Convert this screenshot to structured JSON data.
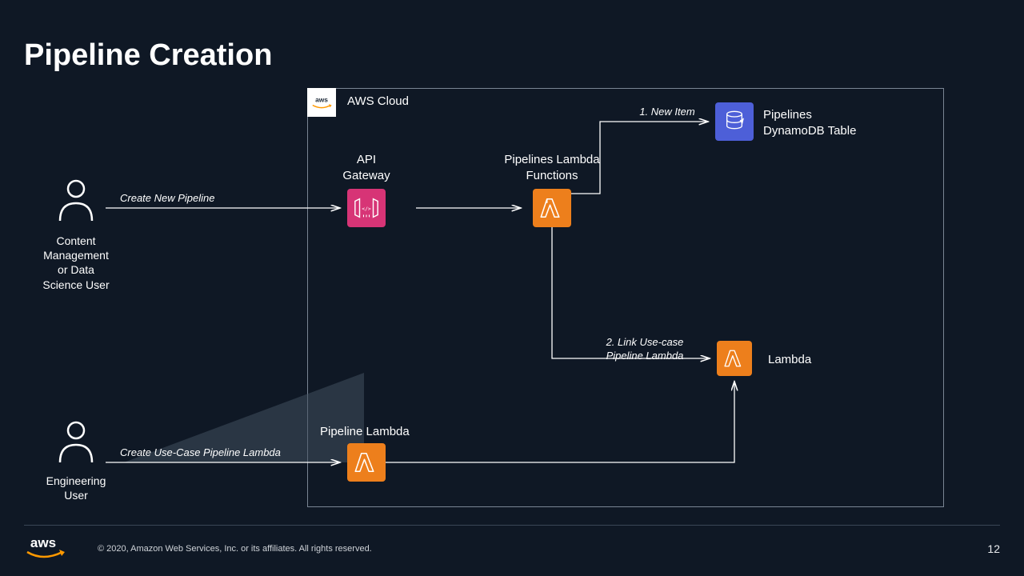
{
  "title": "Pipeline Creation",
  "cloud": {
    "label": "AWS Cloud",
    "logo_text": "aws"
  },
  "users": {
    "top": {
      "label": "Content\nManagement\nor Data\nScience User"
    },
    "bottom": {
      "label": "Engineering\nUser"
    }
  },
  "edges": {
    "create_new": "Create New Pipeline",
    "create_usecase": "Create Use-Case Pipeline Lambda",
    "new_item": "1. New Item",
    "link_usecase": "2. Link Use-case\nPipeline Lambda"
  },
  "nodes": {
    "api_gateway": "API\nGateway",
    "pipelines_lambda": "Pipelines Lambda\nFunctions",
    "dynamo": "Pipelines\nDynamoDB Table",
    "pipeline_lambda": "Pipeline Lambda",
    "lambda": "Lambda"
  },
  "footer": {
    "copyright": "© 2020, Amazon Web Services, Inc. or its affiliates. All rights reserved.",
    "page": "12",
    "logo_text": "aws"
  }
}
